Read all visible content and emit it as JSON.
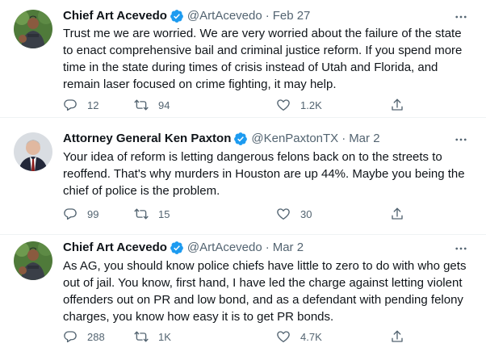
{
  "tweets": [
    {
      "name": "Chief Art Acevedo",
      "handle": "@ArtAcevedo",
      "separator": "·",
      "date": "Feb 27",
      "lines": [
        "Trust me we are worried. We are very worried about the failure of the state",
        "to enact comprehensive bail and criminal justice reform. If you spend more",
        "time in the state during times of crisis instead of Utah and Florida, and",
        "remain laser focused on crime fighting, it may help."
      ],
      "replies": "12",
      "retweets": "94",
      "likes": "1.2K"
    },
    {
      "name": "Attorney General Ken Paxton",
      "handle": "@KenPaxtonTX",
      "separator": "·",
      "date": "Mar 2",
      "lines": [
        "Your idea of reform is letting dangerous felons back on to the streets to",
        "reoffend. That's why murders in Houston are up 44%. Maybe you being the",
        "chief of police is the problem."
      ],
      "replies": "99",
      "retweets": "15",
      "likes": "30"
    },
    {
      "name": "Chief Art Acevedo",
      "handle": "@ArtAcevedo",
      "separator": "·",
      "date": "Mar 2",
      "lines": [
        "As AG, you should know police chiefs have little to zero to do with who gets",
        "out of jail. You know, first hand, I have led the charge against letting violent",
        "offenders out on PR and low bond, and as a defendant with pending felony",
        "charges, you know how easy it is to get PR bonds."
      ],
      "replies": "288",
      "retweets": "1K",
      "likes": "4.7K"
    }
  ],
  "colors": {
    "text": "#0f1419",
    "secondary": "#536471",
    "verified": "#1d9bf0",
    "divider": "#eff3f4"
  },
  "icons": [
    "verified-badge-icon",
    "more-options-icon",
    "reply-icon",
    "retweet-icon",
    "like-icon",
    "share-icon"
  ]
}
